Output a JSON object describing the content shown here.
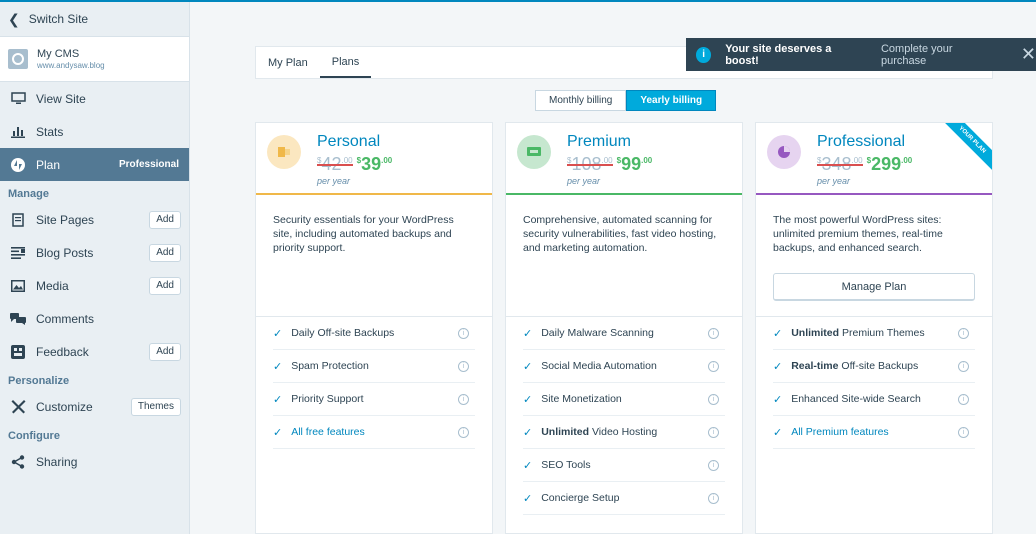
{
  "sidebar": {
    "switch_site": "Switch Site",
    "site": {
      "name": "My CMS",
      "url": "www.andysaw.blog"
    },
    "items_top": [
      {
        "label": "View Site",
        "icon": "monitor-icon"
      },
      {
        "label": "Stats",
        "icon": "bar-chart-icon"
      }
    ],
    "active_item": {
      "label": "Plan",
      "badge": "Professional",
      "icon": "jetpack-icon"
    },
    "sections": {
      "manage": "Manage",
      "personalize": "Personalize",
      "configure": "Configure"
    },
    "manage_items": [
      {
        "label": "Site Pages",
        "action": "Add",
        "icon": "page-icon"
      },
      {
        "label": "Blog Posts",
        "action": "Add",
        "icon": "posts-icon"
      },
      {
        "label": "Media",
        "action": "Add",
        "icon": "image-icon"
      },
      {
        "label": "Comments",
        "action": "",
        "icon": "comments-icon"
      },
      {
        "label": "Feedback",
        "action": "Add",
        "icon": "feedback-icon"
      }
    ],
    "customize": {
      "label": "Customize",
      "action": "Themes",
      "icon": "tools-icon"
    },
    "sharing": {
      "label": "Sharing",
      "icon": "share-icon"
    }
  },
  "tabs": {
    "my_plan": "My Plan",
    "plans": "Plans"
  },
  "notice": {
    "text": "Your site deserves a boost!",
    "link": "Complete your purchase",
    "icon": "i"
  },
  "billing": {
    "monthly": "Monthly billing",
    "yearly": "Yearly billing"
  },
  "plans": [
    {
      "name": "Personal",
      "old_currency": "$",
      "old_price": "42",
      "old_cents": ".00",
      "new_currency": "$",
      "new_price": "39",
      "new_cents": ".00",
      "per": "per year",
      "description": "Security essentials for your WordPress site, including automated backups and priority support.",
      "accent": "#f0b849",
      "features": [
        "Daily Off-site Backups",
        "Spam Protection",
        "Priority Support"
      ],
      "link_feature": "All free features"
    },
    {
      "name": "Premium",
      "old_currency": "$",
      "old_price": "108",
      "old_cents": ".00",
      "new_currency": "$",
      "new_price": "99",
      "new_cents": ".00",
      "per": "per year",
      "description": "Comprehensive, automated scanning for security vulnerabilities, fast video hosting, and marketing automation.",
      "accent": "#4ab866",
      "features": [
        "Daily Malware Scanning",
        "Social Media Automation",
        "Site Monetization"
      ],
      "feature_bold_prefix": "Unlimited",
      "feature_bold_rest": "Video Hosting",
      "features_after": [
        "SEO Tools",
        "Concierge Setup"
      ]
    },
    {
      "name": "Professional",
      "old_currency": "$",
      "old_price": "348",
      "old_cents": ".00",
      "new_currency": "$",
      "new_price": "299",
      "new_cents": ".00",
      "per": "per year",
      "description": "The most powerful WordPress sites: unlimited premium themes, real-time backups, and enhanced search.",
      "accent": "#9658c0",
      "ribbon": "YOUR PLAN",
      "manage_button": "Manage Plan",
      "bold_feature_1": {
        "bold": "Unlimited",
        "rest": "Premium Themes"
      },
      "bold_feature_2": {
        "bold": "Real-time",
        "rest": "Off-site Backups"
      },
      "features": [
        "Enhanced Site-wide Search"
      ],
      "link_feature": "All Premium features"
    }
  ]
}
